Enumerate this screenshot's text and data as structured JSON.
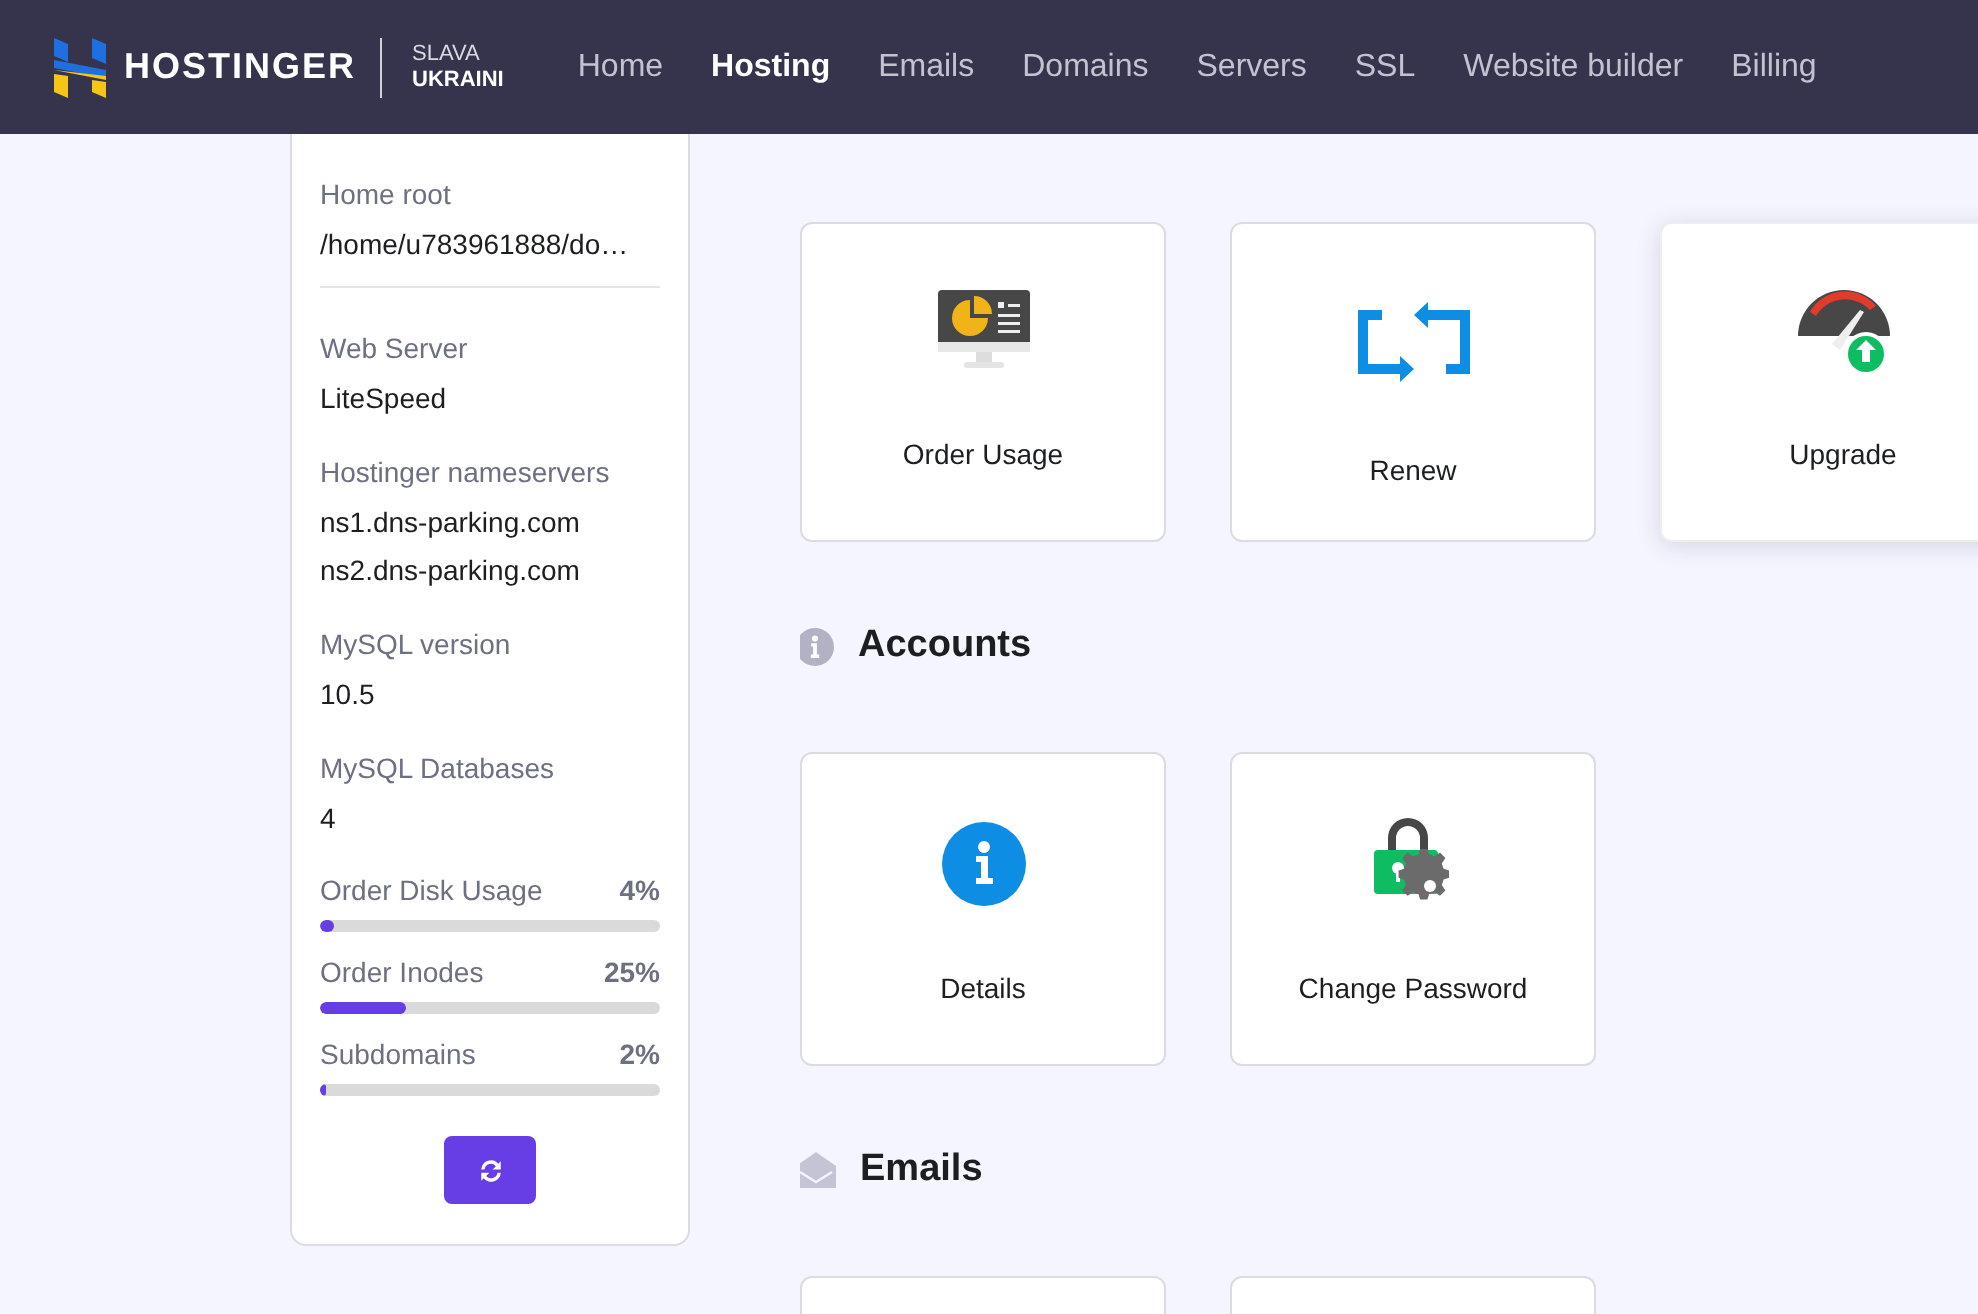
{
  "header": {
    "brand": "HOSTINGER",
    "tagline_top": "SLAVA",
    "tagline_bottom": "UKRAINI",
    "nav": [
      {
        "label": "Home",
        "selected": false
      },
      {
        "label": "Hosting",
        "selected": true
      },
      {
        "label": "Emails",
        "selected": false
      },
      {
        "label": "Domains",
        "selected": false
      },
      {
        "label": "Servers",
        "selected": false
      },
      {
        "label": "SSL",
        "selected": false
      },
      {
        "label": "Website builder",
        "selected": false
      },
      {
        "label": "Billing",
        "selected": false
      }
    ]
  },
  "sidebar": {
    "detail_groups": [
      [
        {
          "label": "Home root",
          "values": [
            "/home/u783961888/do…"
          ]
        }
      ],
      [
        {
          "label": "Web Server",
          "values": [
            "LiteSpeed"
          ]
        },
        {
          "label": "Hostinger nameservers",
          "values": [
            "ns1.dns-parking.com",
            "ns2.dns-parking.com"
          ]
        },
        {
          "label": "MySQL version",
          "values": [
            "10.5"
          ]
        },
        {
          "label": "MySQL Databases",
          "values": [
            "4"
          ]
        }
      ]
    ],
    "usage": [
      {
        "label": "Order Disk Usage",
        "reading": "4%",
        "level": 0.04
      },
      {
        "label": "Order Inodes",
        "reading": "25%",
        "level": 0.25
      },
      {
        "label": "Subdomains",
        "reading": "2%",
        "level": 0.02
      }
    ]
  },
  "sections": [
    {
      "cards": [
        {
          "kind": "usage",
          "label": "Order Usage",
          "highlighted": false
        },
        {
          "kind": "renew",
          "label": "Renew",
          "highlighted": false
        },
        {
          "kind": "upgrade",
          "label": "Upgrade",
          "highlighted": true
        }
      ]
    },
    {
      "title": "Accounts",
      "kind": "info",
      "cards": [
        {
          "kind": "details",
          "label": "Details",
          "highlighted": false
        },
        {
          "kind": "password",
          "label": "Change Password",
          "highlighted": false
        }
      ]
    },
    {
      "title": "Emails",
      "kind": "envelope",
      "cards": [
        {
          "kind": "tile",
          "highlighted": false
        },
        {
          "kind": "tile",
          "highlighted": false
        }
      ]
    }
  ]
}
